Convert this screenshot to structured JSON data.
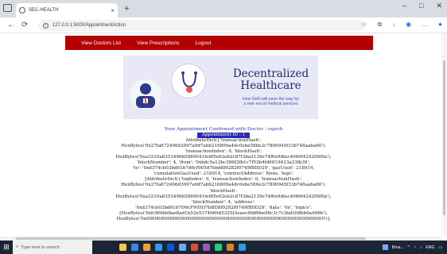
{
  "browser": {
    "tab_title": "SEC-HEALTH",
    "tab_close": "×",
    "new_tab": "+",
    "url": "127.0.0.1:5000/AppointmentAction",
    "win_buttons": [
      "–",
      "□",
      "✕"
    ]
  },
  "navbar": {
    "items": [
      "View Doctors List",
      "View Prescriptions",
      "Logout"
    ]
  },
  "hero": {
    "title_line1": "Decentralized",
    "title_line2": "Healthcare",
    "subtitle_line1": "How DeFi will pave the way for",
    "subtitle_line2": "a new era of medical services"
  },
  "content": {
    "confirm_text": "Your Appointment Confirmed with Doctor : rajesh",
    "appointment_id": "Appointment ID : 1",
    "lines": [
      "AttributeDict({'transactionHash':",
      "HexBytes('0x27fa672496d3097a9d7abb216809a4dc0ebe586e2c7800945f33b748aaba60'),",
      "'transactionIndex': 0, 'blockHash':",
      "HexBytes('0xa3210a8353496b5869041fe6f5e62eb2c87f3ba2139e74f6e9dfac4066f424206f0a'),",
      "'blockNumber': 4, 'from': '0xbdc5a12bc386f2fb1c7f53b4fd6819433a33fb39',",
      "'to': '0xd374cb03bd61b7d6cf905d7bbd8f9282f0749fBDD29', 'gasUsed': 218914,",
      "'cumulativeGasUsed': 218914, 'contractAddress': None, 'logs':",
      "[AttributeDict({'logIndex': 0, 'transactionIndex': 0, 'transactionHash':",
      "HexBytes('0x27fa672496d3097a9d7abb216809a4dc0ebe586e2c7800945f33b748aaba60'),",
      "'blockHash':",
      "HexBytes('0xa3210a8353496b5869041fe6f5e62eb2c87f3ba2139e74f6e9dfac4066f424206f0a'),",
      "'blockNumber': 4, 'address':",
      "'0xd374cb03bd61b7D6cF905D7bBD8f9282f0749fBDD29', 'data': '0x', 'topics':",
      "[HexBytes('0xfc8f0bb8ae8ad1b52e5374969d5325f3eaecf0df6be98c3c7c3bd208bb0a496b'),",
      "HexBytes('0x000000000000000000000000000000000000000000000000000000000000000')],"
    ]
  },
  "taskbar": {
    "search_placeholder": "Type here to search",
    "weather": "Brea...",
    "lang": "ENG"
  },
  "colors": {
    "navbar": "#b30000",
    "accent": "#2a39c9",
    "taskbar": "#1b2533"
  }
}
